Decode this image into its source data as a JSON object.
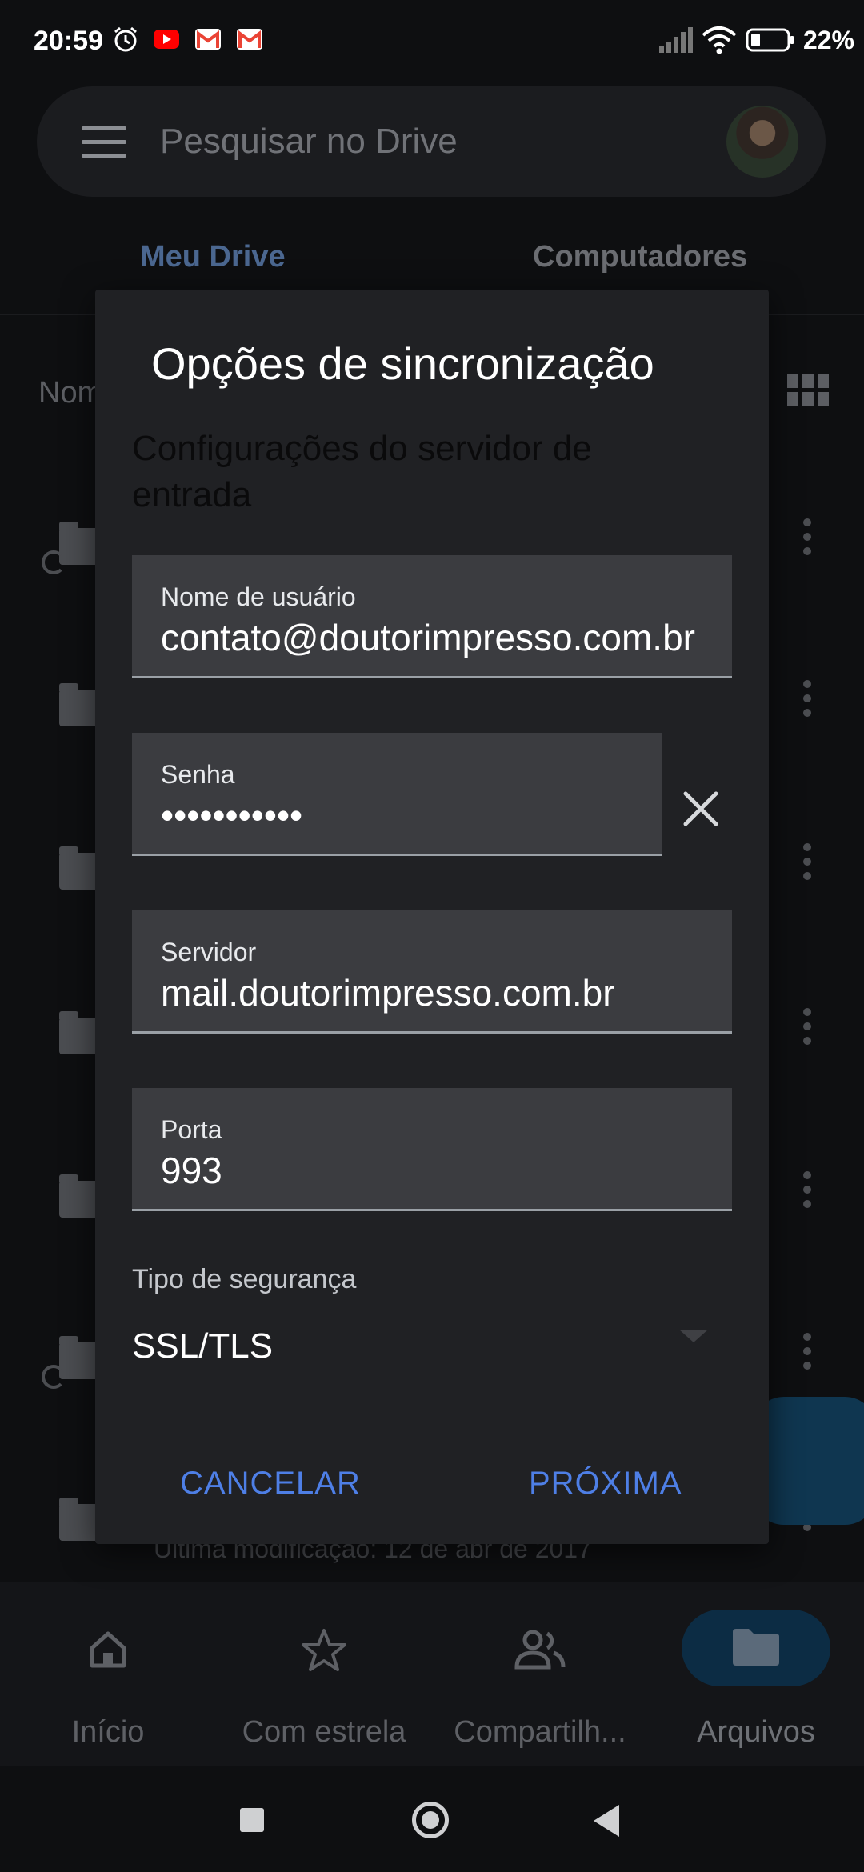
{
  "status_bar": {
    "time": "20:59",
    "battery_percent": "22%",
    "icons": [
      "alarm-icon",
      "youtube-icon",
      "gmail-icon",
      "gmail-icon",
      "signal-icon",
      "wifi-icon",
      "battery-icon"
    ]
  },
  "drive": {
    "search_placeholder": "Pesquisar no Drive",
    "tabs": [
      {
        "label": "Meu Drive",
        "active": true
      },
      {
        "label": "Computadores",
        "active": false
      }
    ],
    "sort_label_partial": "Nom",
    "last_modified_text": "Última modificação: 12 de abr de 2017"
  },
  "dialog": {
    "title": "Opções de sincronização",
    "subtitle": "Configurações do servidor de entrada",
    "fields": {
      "username": {
        "label": "Nome de usuário",
        "value": "contato@doutorimpresso.com.br"
      },
      "password": {
        "label": "Senha",
        "value": "•••••••••••"
      },
      "server": {
        "label": "Servidor",
        "value": "mail.doutorimpresso.com.br"
      },
      "port": {
        "label": "Porta",
        "value": "993"
      }
    },
    "security": {
      "label": "Tipo de segurança",
      "value": "SSL/TLS"
    },
    "cancel_label": "CANCELAR",
    "next_label": "PRÓXIMA"
  },
  "bottom_nav": {
    "items": [
      {
        "label": "Início",
        "icon": "home-icon"
      },
      {
        "label": "Com estrela",
        "icon": "star-icon"
      },
      {
        "label": "Compartilh...",
        "icon": "people-icon"
      },
      {
        "label": "Arquivos",
        "icon": "folder-icon",
        "active": true
      }
    ]
  },
  "colors": {
    "accent": "#4e7fe6",
    "dialog_bg": "#202124",
    "field_bg": "#3b3c40"
  }
}
